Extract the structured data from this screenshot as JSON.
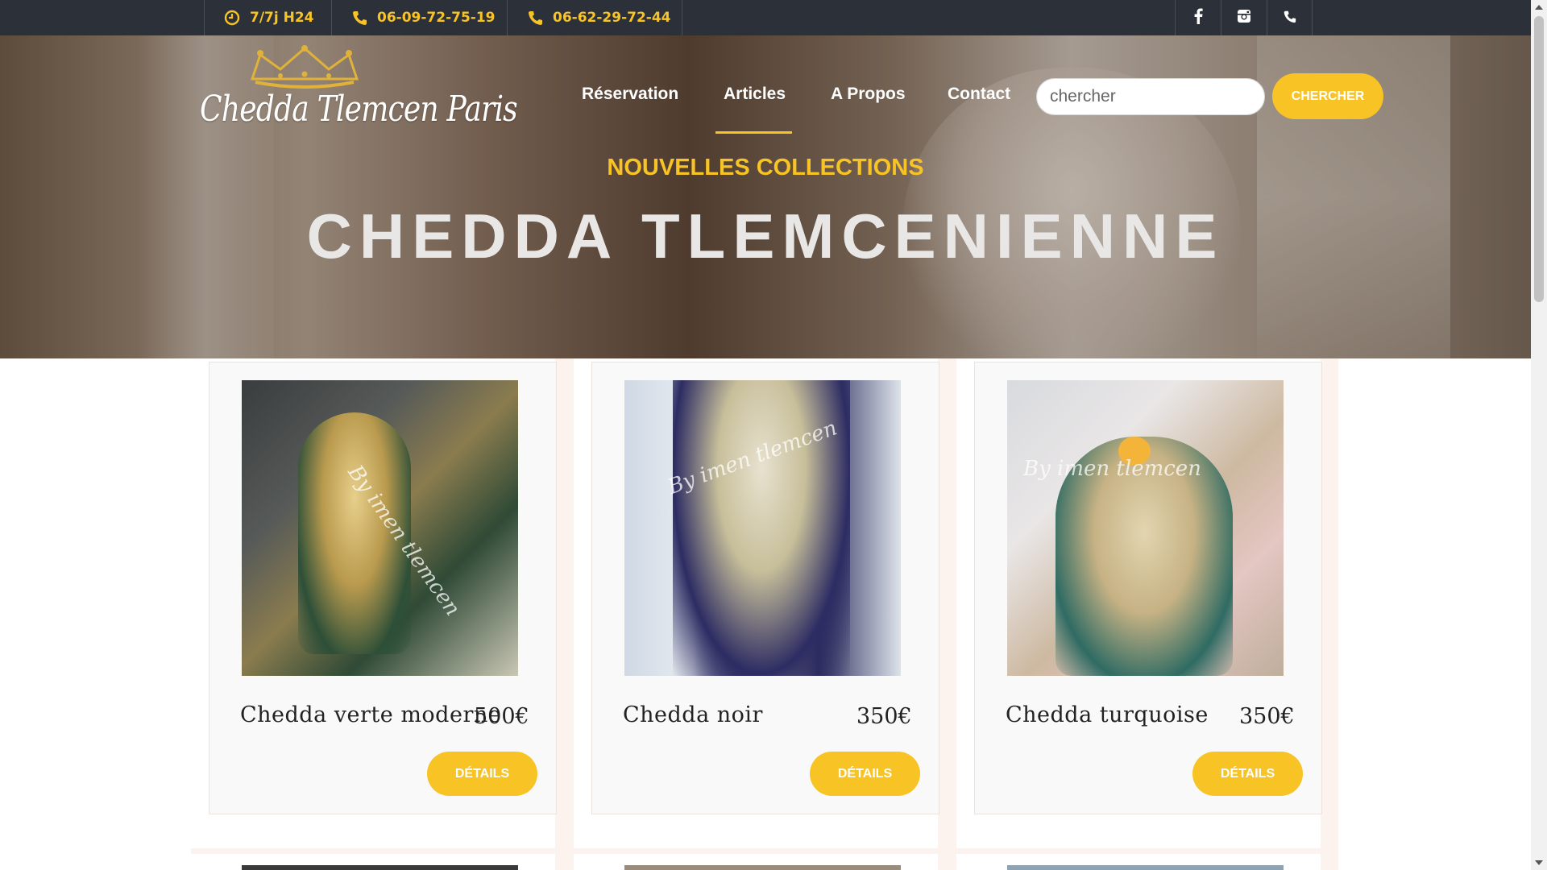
{
  "topbar": {
    "hours": "7/7j H24",
    "phone1": "06-09-72-75-19",
    "phone2": "06-62-29-72-44",
    "icons": [
      "clock-icon",
      "phone-icon",
      "phone-icon",
      "facebook-icon",
      "instagram-icon",
      "phone-icon"
    ]
  },
  "brand": {
    "logo_text": "Chedda Tlemcen Paris"
  },
  "nav": {
    "items": [
      {
        "label": "Réservation"
      },
      {
        "label": "Articles",
        "active": true
      },
      {
        "label": "A Propos"
      },
      {
        "label": "Contact"
      }
    ]
  },
  "search": {
    "placeholder": "chercher",
    "button_label": "CHERCHER"
  },
  "hero": {
    "subtitle": "NOUVELLES COLLECTIONS",
    "title": "CHEDDA TLEMCENIENNE"
  },
  "products": [
    {
      "name": "Chedda verte moderne",
      "price": "500€",
      "button_label": "DÉTAILS",
      "watermark": "By imen tlemcen"
    },
    {
      "name": "Chedda noir",
      "price": "350€",
      "button_label": "DÉTAILS",
      "watermark": "By imen tlemcen"
    },
    {
      "name": "Chedda turquoise",
      "price": "350€",
      "button_label": "DÉTAILS",
      "watermark": "By imen tlemcen"
    }
  ],
  "colors": {
    "accent": "#f7c325",
    "topbar": "#2c3039",
    "product_bg": "#fcf3ee"
  }
}
